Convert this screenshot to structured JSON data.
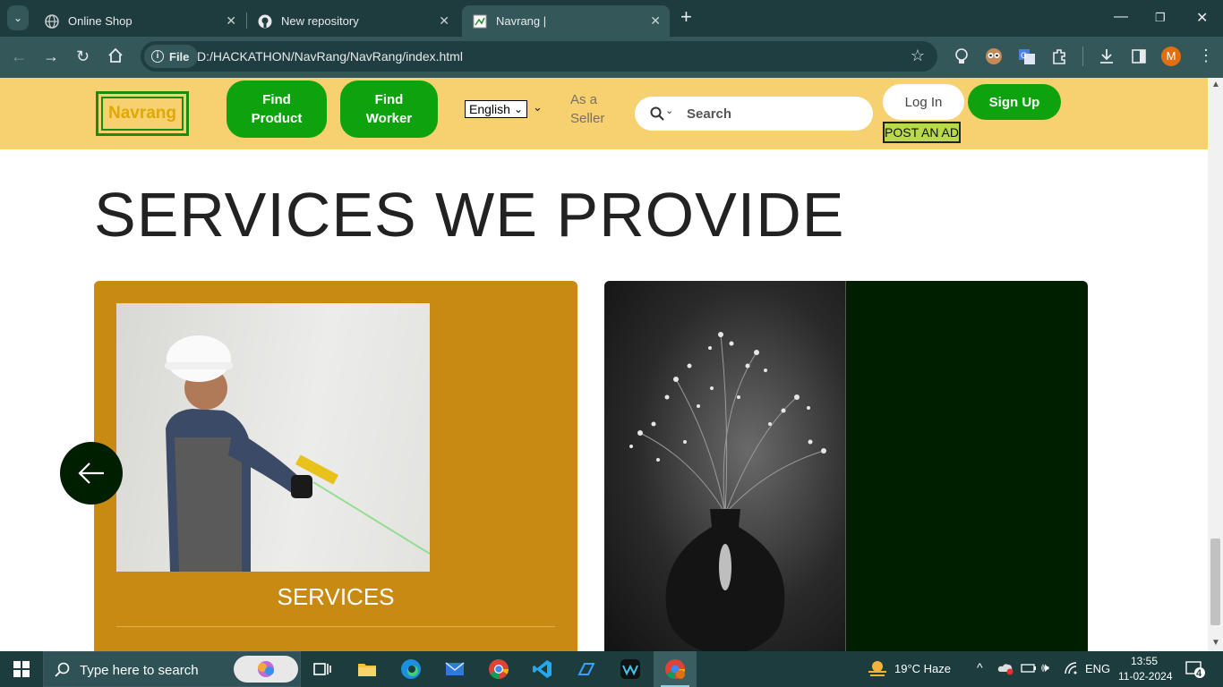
{
  "browser": {
    "tabs": [
      {
        "title": "Online Shop",
        "active": false
      },
      {
        "title": "New repository",
        "active": false
      },
      {
        "title": "Navrang |",
        "active": true
      }
    ],
    "file_chip": "File",
    "url": "D:/HACKATHON/NavRang/NavRang/index.html",
    "profile_initial": "M"
  },
  "site": {
    "logo_text": "Navrang",
    "nav": {
      "find_product": [
        "Find",
        "Product"
      ],
      "find_worker": [
        "Find",
        "Worker"
      ]
    },
    "language": "English",
    "seller": [
      "As a",
      "Seller"
    ],
    "search_placeholder": "Search",
    "login": "Log In",
    "signup": "Sign Up",
    "post_ad": "POST AN AD"
  },
  "main": {
    "section_title": "SERVICES WE PROVIDE",
    "cards": [
      {
        "label": "SERVICES"
      }
    ]
  },
  "taskbar": {
    "search_placeholder": "Type here to search",
    "weather": "19°C  Haze",
    "lang": "ENG",
    "time": "13:55",
    "date": "11-02-2024",
    "notifications": "4"
  },
  "colors": {
    "header_bg": "#f7d070",
    "accent_green": "#0ea30e",
    "card_gold": "#c88a12",
    "card_dark_green": "#001e00"
  }
}
